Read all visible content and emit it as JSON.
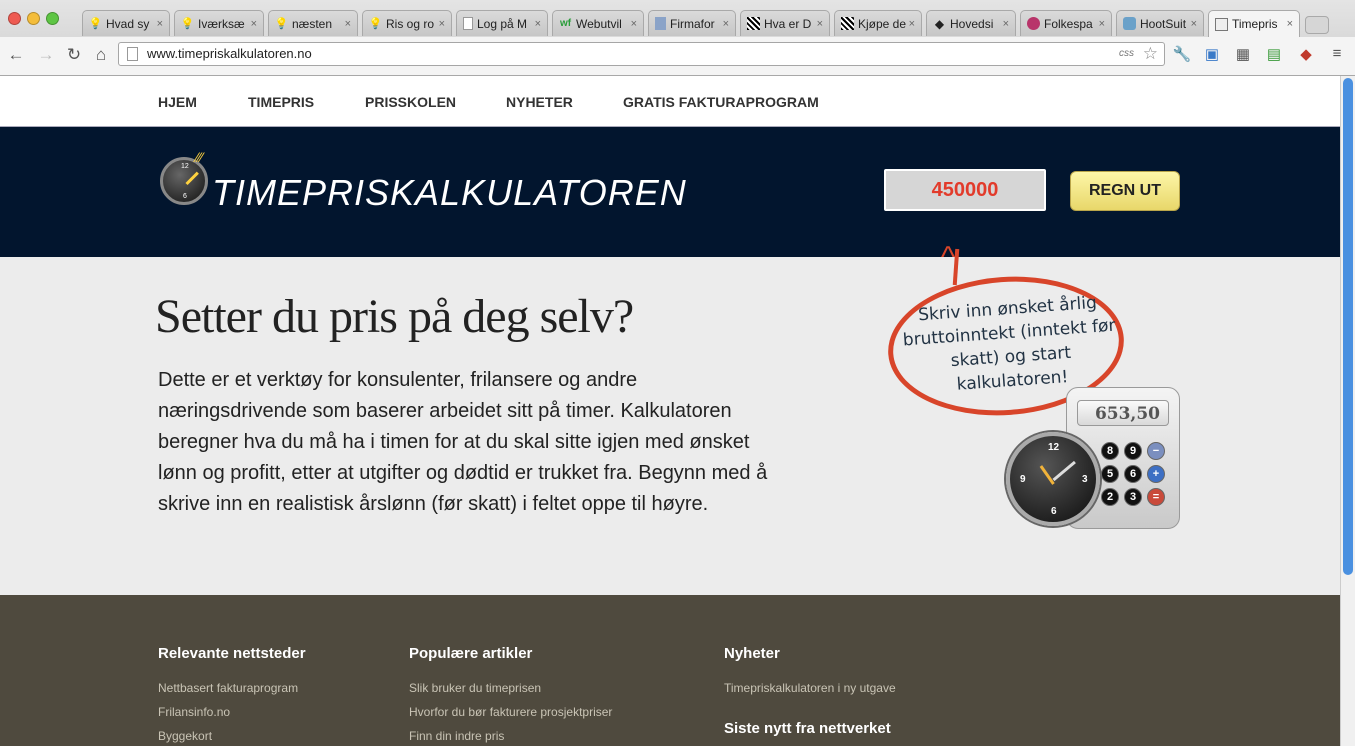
{
  "browser": {
    "tabs": [
      {
        "title": "Hvad sy",
        "icon": "lightbulb-icon"
      },
      {
        "title": "Iværksæ",
        "icon": "lightbulb-icon"
      },
      {
        "title": "næsten",
        "icon": "lightbulb-icon"
      },
      {
        "title": "Ris og ro",
        "icon": "lightbulb-icon"
      },
      {
        "title": "Log på M",
        "icon": "page-icon"
      },
      {
        "title": "Webutvil",
        "icon": "wf-icon"
      },
      {
        "title": "Firmafor",
        "icon": "doc-icon"
      },
      {
        "title": "Hva er D",
        "icon": "stripes-icon"
      },
      {
        "title": "Kjøpe de",
        "icon": "stripes-icon"
      },
      {
        "title": "Hovedsi",
        "icon": "diamond-icon"
      },
      {
        "title": "Folkespa",
        "icon": "folkespa-icon"
      },
      {
        "title": "HootSuit",
        "icon": "owl-icon"
      },
      {
        "title": "Timepris",
        "icon": "calculator-icon"
      }
    ],
    "tab_close": "×",
    "url": "www.timepriskalkulatoren.no",
    "css_badge": "css"
  },
  "nav": {
    "items": [
      "HJEM",
      "TIMEPRIS",
      "PRISSKOLEN",
      "NYHETER",
      "GRATIS FAKTURAPROGRAM"
    ]
  },
  "banner": {
    "logo_text": "TIMEPRISKALKULATOREN",
    "salary_value": "450000",
    "calc_button": "REGN UT"
  },
  "main": {
    "headline": "Setter du pris på deg selv?",
    "intro": "Dette er et verktøy for konsulenter, frilansere og andre næringsdrivende som baserer arbeidet sitt på timer. Kalkulatoren beregner hva du må ha i timen for at du skal sitte igjen med ønsket lønn og profitt, etter at utgifter og dødtid er trukket fra. Begynn med å skrive inn en realistisk årslønn (før skatt) i feltet oppe til høyre.",
    "bubble": "Skriv inn ønsket årlig bruttoinntekt (inntekt før skatt) og start kalkulatoren!",
    "calc_display": "653,50",
    "calc_keys": [
      "8",
      "9",
      "−",
      "5",
      "6",
      "+",
      "2",
      "3",
      "="
    ],
    "clock_numbers": [
      "12",
      "3",
      "6",
      "9"
    ]
  },
  "footer": {
    "col1": {
      "heading": "Relevante nettsteder",
      "links": [
        "Nettbasert fakturaprogram",
        "Frilansinfo.no",
        "Byggekort"
      ]
    },
    "col2": {
      "heading": "Populære artikler",
      "links": [
        "Slik bruker du timeprisen",
        "Hvorfor du bør fakturere prosjektpriser",
        "Finn din indre pris"
      ]
    },
    "col3": {
      "heading": "Nyheter",
      "links": [
        "Timepriskalkulatoren i ny utgave"
      ],
      "heading2": "Siste nytt fra nettverket"
    }
  },
  "colors": {
    "banner": "#02152e",
    "accent_red": "#e23b2b",
    "footer": "#4f4a3e",
    "button": "#f3e68a"
  }
}
